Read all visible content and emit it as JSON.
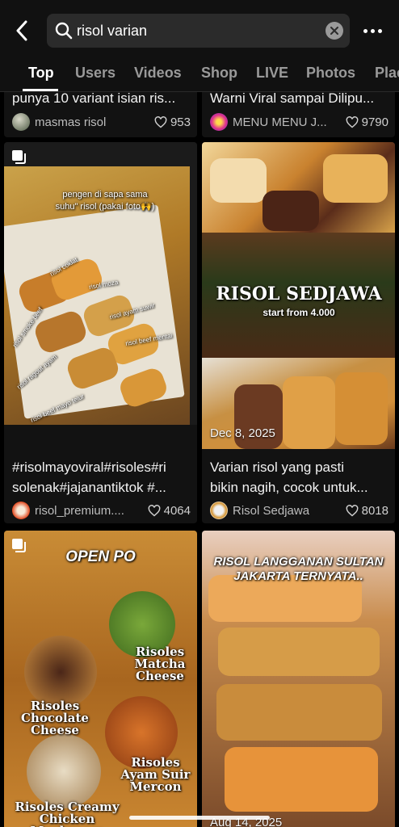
{
  "search": {
    "query": "risol varian"
  },
  "tabs": [
    "Top",
    "Users",
    "Videos",
    "Shop",
    "LIVE",
    "Photos",
    "Places"
  ],
  "cards": [
    {
      "caption": "punya 10 variant isian ris...",
      "user": "masmas risol",
      "likes": "953"
    },
    {
      "caption": "Warni Viral sampai Dilipu...",
      "user": "MENU MENU J...",
      "likes": "9790"
    },
    {
      "overlay_lines": [
        "pengen di sapa sama",
        "suhu\" risol (pakai foto🙌)"
      ],
      "labels": [
        "risol coklat",
        "risol moza",
        "risol ayam suwir",
        "risol smoke beef",
        "risol beef mentai",
        "risol ragout ayam",
        "risol beef mayo telur"
      ],
      "caption": "#risolmayoviral#risoles#ri",
      "caption2": "solenak#jajanantiktok #...",
      "user": "risol_premium....",
      "likes": "4064"
    },
    {
      "overlay_title": "RISOL SEDJAWA",
      "overlay_sub": "start from 4.000",
      "date": "Dec 8, 2025",
      "caption": "Varian risol yang pasti",
      "caption2": "bikin nagih, cocok untuk...",
      "user": "Risol Sedjawa",
      "likes": "8018"
    },
    {
      "overlay_title": "OPEN PO",
      "labels": [
        "Risoles Matcha Cheese",
        "Risoles Chocolate Cheese",
        "Risoles Ayam Suir Mercon",
        "Risoles Creamy Chicken Mushroom"
      ]
    },
    {
      "overlay_title": "RISOL LANGGANAN SULTAN JAKARTA TERNYATA..",
      "date": "Aug 14, 2025"
    }
  ],
  "colors": {
    "background": "#000000",
    "card": "#121212",
    "muted": "#9a9a9a",
    "fried": "#d9902e"
  }
}
